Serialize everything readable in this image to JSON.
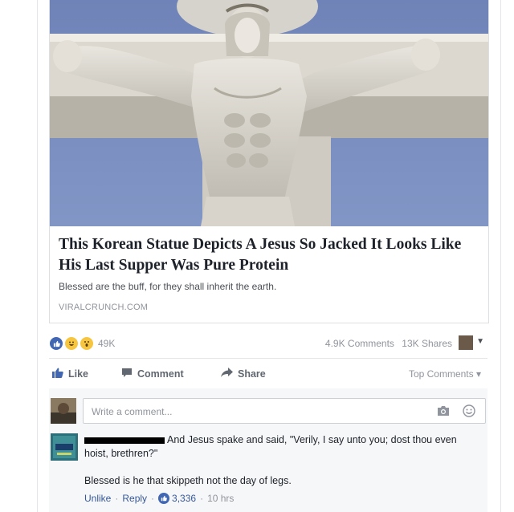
{
  "article": {
    "title": "This Korean Statue Depicts A Jesus So Jacked It Looks Like His Last Supper Was Pure Protein",
    "description": "Blessed are the buff, for they shall inherit the earth.",
    "domain": "VIRALCRUNCH.COM"
  },
  "reactions": {
    "icons": [
      "like-icon",
      "haha-icon",
      "wow-icon"
    ],
    "count": "49K"
  },
  "stats": {
    "comments": "4.9K Comments",
    "shares": "13K Shares"
  },
  "actions": {
    "like": "Like",
    "comment": "Comment",
    "share": "Share",
    "top_comments": "Top Comments ▾"
  },
  "composer": {
    "placeholder": "Write a comment..."
  },
  "comment": {
    "text": "And Jesus spake and said, \"Verily, I say unto you; dost thou even hoist, brethren?\"",
    "reply_text": "Blessed is he that skippeth not the day of legs.",
    "unlike": "Unlike",
    "reply": "Reply",
    "likes": "3,336",
    "time": "10 hrs"
  },
  "colors": {
    "link": "#365899",
    "like_blue": "#4267b2",
    "muted": "#90949c"
  }
}
